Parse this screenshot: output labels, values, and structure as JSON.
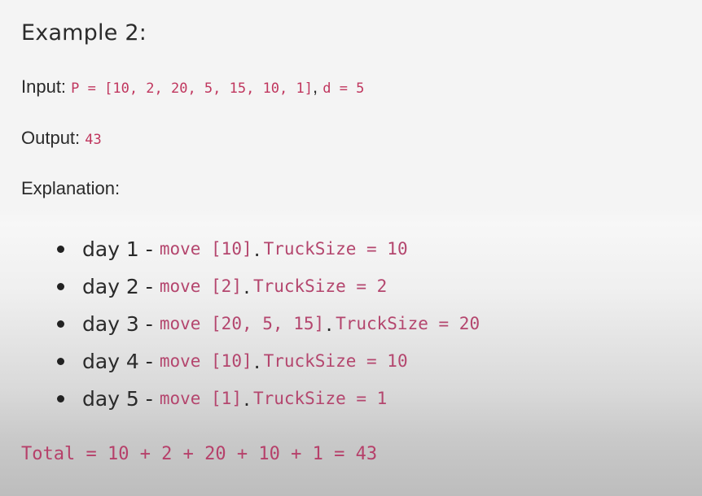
{
  "title": "Example 2:",
  "input": {
    "label": "Input:",
    "p_code": "P = [10, 2, 20, 5, 15, 10, 1]",
    "separator": ",",
    "d_code": "d = 5"
  },
  "output": {
    "label": "Output:",
    "value": "43"
  },
  "explanation": {
    "label": "Explanation:"
  },
  "steps": [
    {
      "day": "day 1",
      "dash": "-",
      "move": "move [10]",
      "dot": ".",
      "truck": "TruckSize = 10"
    },
    {
      "day": "day 2",
      "dash": "-",
      "move": "move [2]",
      "dot": ".",
      "truck": "TruckSize = 2"
    },
    {
      "day": "day 3",
      "dash": "-",
      "move": "move [20, 5, 15]",
      "dot": ".",
      "truck": "TruckSize = 20"
    },
    {
      "day": "day 4",
      "dash": "-",
      "move": "move [10]",
      "dot": ".",
      "truck": "TruckSize = 10"
    },
    {
      "day": "day 5",
      "dash": "-",
      "move": "move [1]",
      "dot": ".",
      "truck": "TruckSize = 1"
    }
  ],
  "total": "Total = 10 + 2 + 20 + 10 + 1 = 43",
  "colors": {
    "code": "#c0365e",
    "text": "#2a2a2a"
  }
}
